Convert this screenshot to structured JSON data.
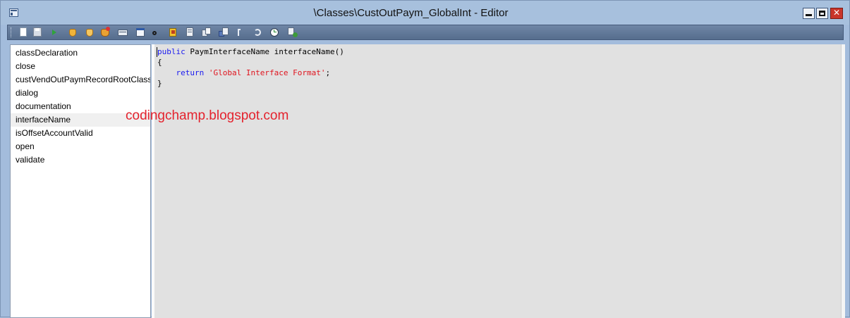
{
  "window": {
    "title": "\\Classes\\CustOutPaym_GlobalInt - Editor",
    "controls": {
      "minimize": "minimize",
      "maximize": "maximize",
      "close": "✕"
    }
  },
  "toolbar": {
    "icons": [
      "new-icon",
      "save-icon",
      "run-icon",
      "breakpoint-icon",
      "enable-breakpoint-icon",
      "remove-breakpoints-icon",
      "compile-icon",
      "lookup-icon",
      "find-icon",
      "scripts-icon",
      "list-properties-icon",
      "copy-icon",
      "paste-icon",
      "outline-icon",
      "undo-icon",
      "history-icon",
      "source-control-icon",
      "help-icon"
    ]
  },
  "methods": {
    "items": [
      "classDeclaration",
      "close",
      "custVendOutPaymRecordRootClassI",
      "dialog",
      "documentation",
      "interfaceName",
      "isOffsetAccountValid",
      "open",
      "validate"
    ],
    "selected": "interfaceName"
  },
  "code": {
    "line1_kw": "public",
    "line1_rest": " PaymInterfaceName interfaceName()",
    "line2": "{",
    "line3_indent": "    ",
    "line3_kw": "return",
    "line3_space": " ",
    "line3_str": "'Global Interface Format'",
    "line3_end": ";",
    "line4": "}"
  },
  "watermark": "codingchamp.blogspot.com",
  "colors": {
    "keyword": "#1a1af0",
    "string": "#e0141e",
    "watermark": "#e4222d",
    "editor_bg": "#e1e1e1"
  }
}
